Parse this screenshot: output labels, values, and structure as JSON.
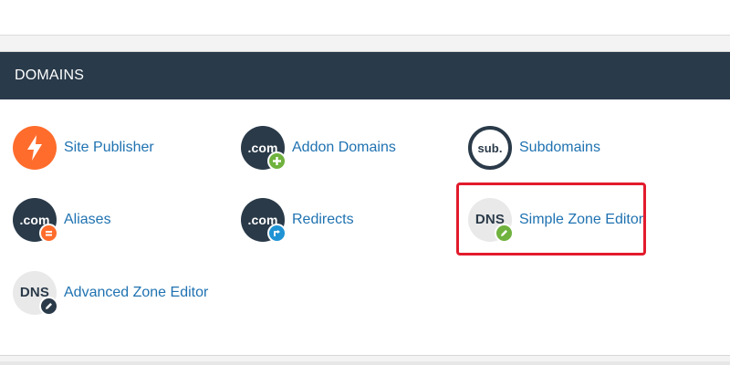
{
  "section": {
    "title": "DOMAINS"
  },
  "items": [
    {
      "name": "site-publisher",
      "label": "Site Publisher",
      "icon": "lightning-bolt-icon"
    },
    {
      "name": "addon-domains",
      "label": "Addon Domains",
      "icon_text": ".com",
      "badge": "plus-icon"
    },
    {
      "name": "subdomains",
      "label": "Subdomains",
      "icon_text": "sub."
    },
    {
      "name": "aliases",
      "label": "Aliases",
      "icon_text": ".com",
      "badge": "equals-icon"
    },
    {
      "name": "redirects",
      "label": "Redirects",
      "icon_text": ".com",
      "badge": "redirect-arrow-icon"
    },
    {
      "name": "simple-zone-editor",
      "label": "Simple Zone Editor",
      "icon_text": "DNS",
      "badge": "pencil-icon",
      "highlighted": true
    },
    {
      "name": "advanced-zone-editor",
      "label": "Advanced Zone Editor",
      "icon_text": "DNS",
      "badge": "pencil-icon"
    }
  ],
  "colors": {
    "header_bg": "#293a4a",
    "link": "#1f72b1",
    "orange": "#ff6c2c",
    "green": "#6fb23e",
    "blue": "#1f93d4",
    "highlight": "#e21b2c"
  }
}
